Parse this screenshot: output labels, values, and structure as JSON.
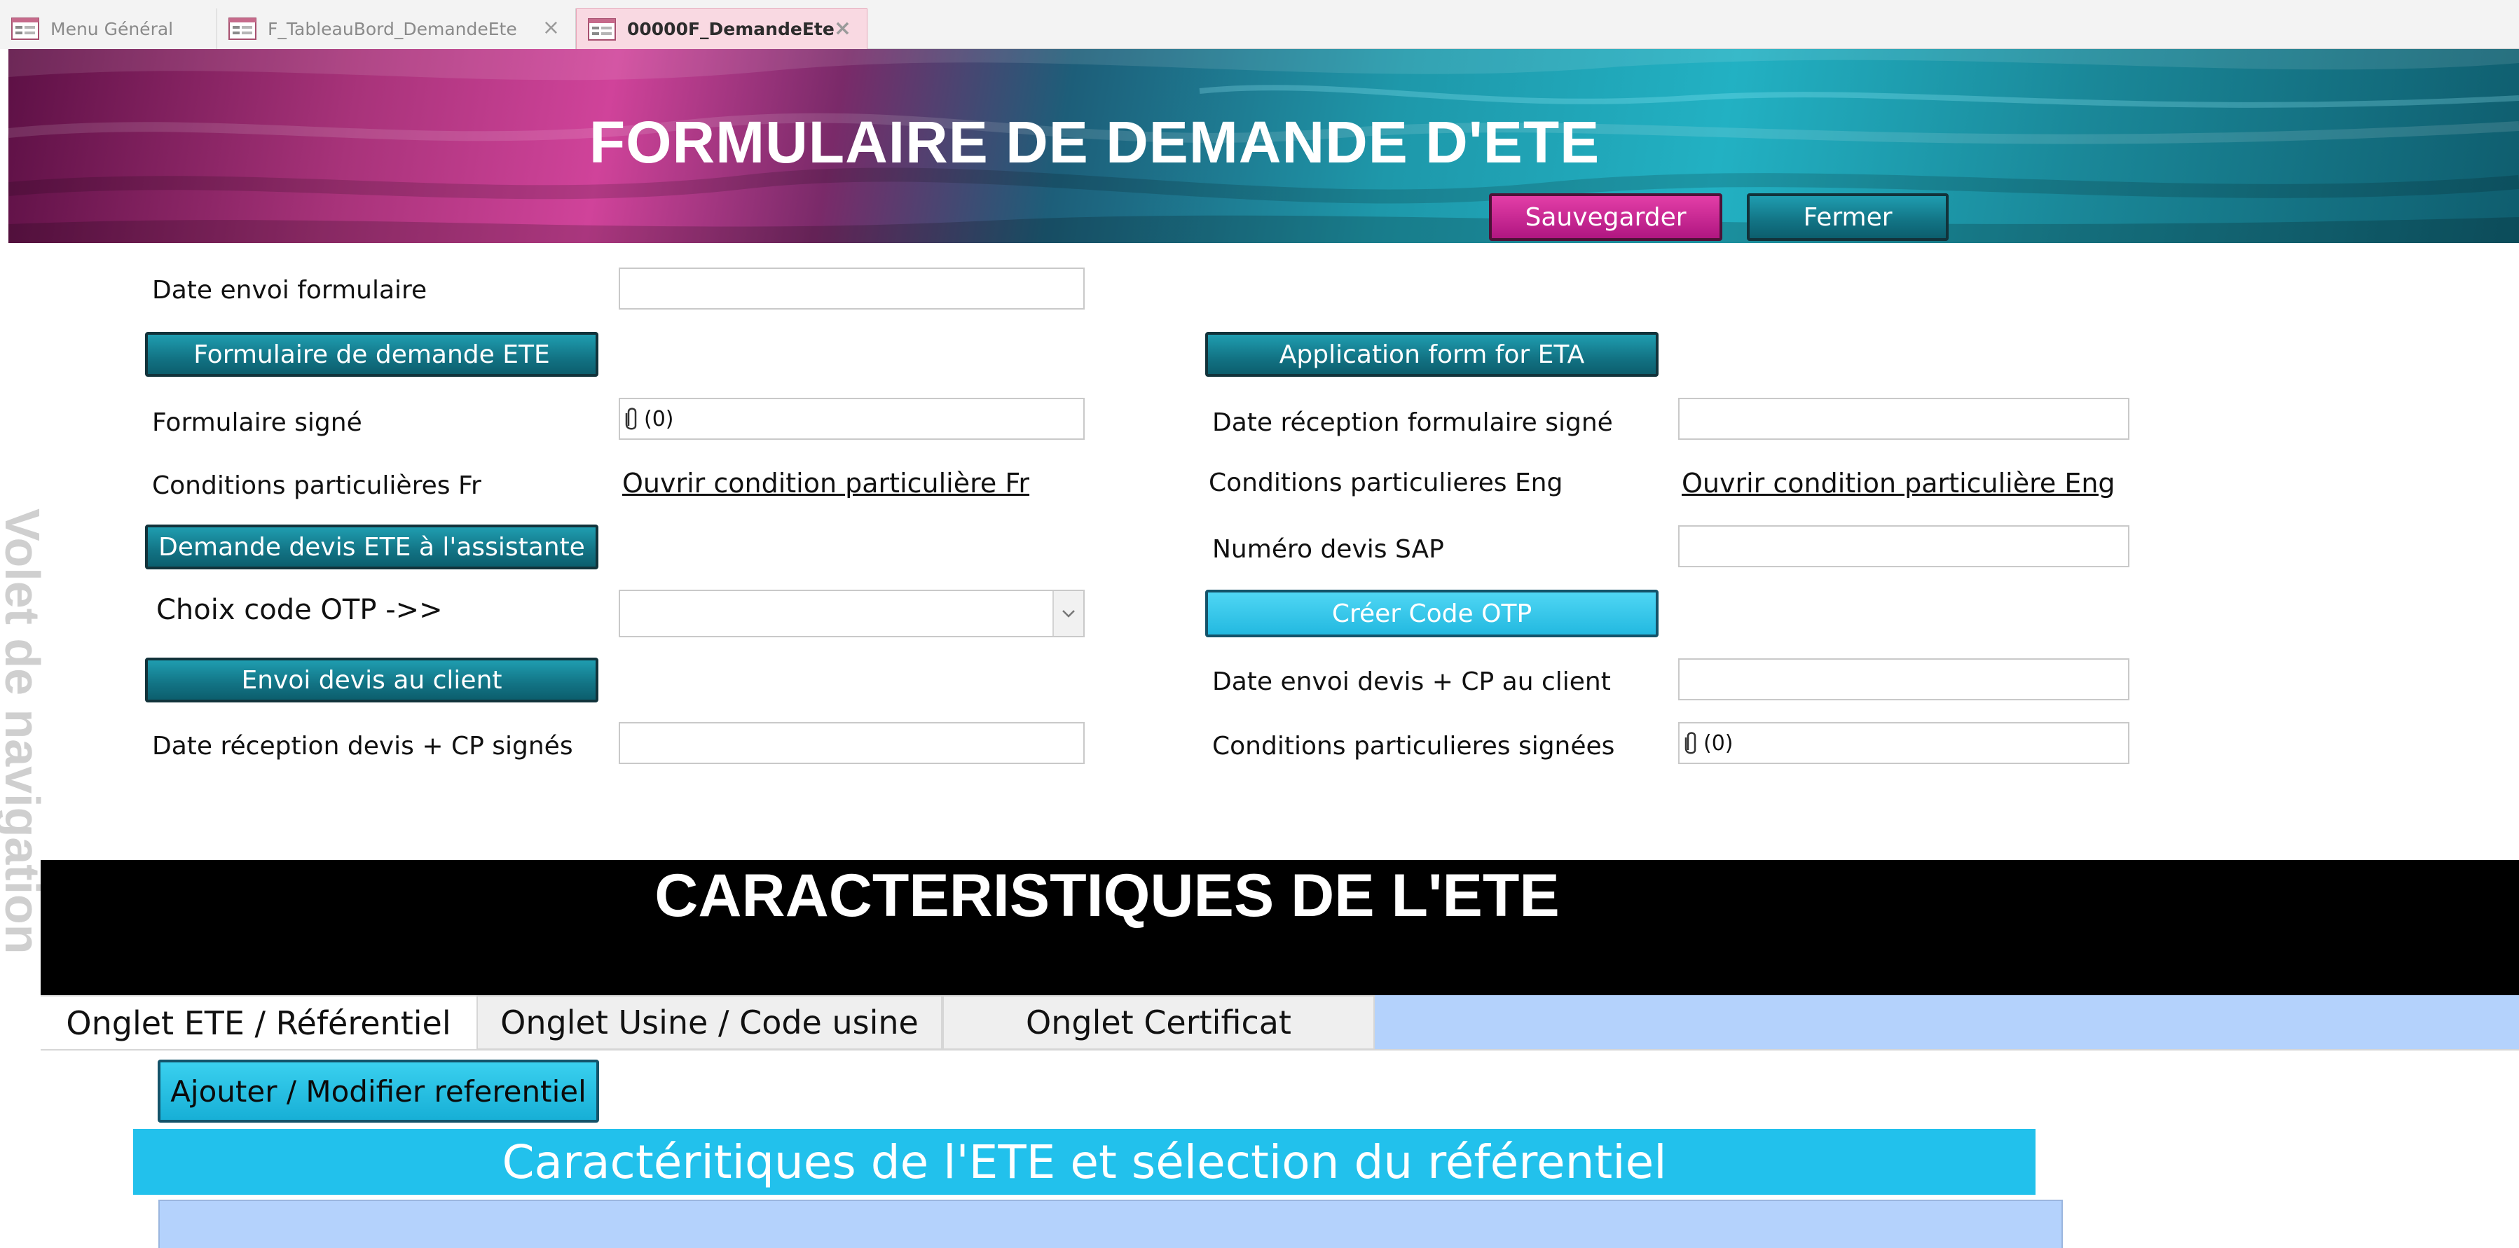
{
  "document_tabs": [
    {
      "label": "Menu Général",
      "icon": "form-icon",
      "active": false
    },
    {
      "label": "F_TableauBord_DemandeEte",
      "icon": "form-icon",
      "active": false,
      "close": "×"
    },
    {
      "label": "00000F_DemandeEte",
      "icon": "form-icon",
      "active": true,
      "close": "×"
    }
  ],
  "header": {
    "title": "FORMULAIRE DE DEMANDE D'ETE",
    "save_button": "Sauvegarder",
    "close_button": "Fermer"
  },
  "navigation_pane_label": "Volet de navigation",
  "form": {
    "date_envoi_label": "Date envoi formulaire",
    "date_envoi_value": "",
    "btn_formulaire_fr": "Formulaire de demande ETE",
    "btn_application_eta": "Application form for ETA",
    "formulaire_signe_label": "Formulaire signé",
    "formulaire_signe_value": "(0)",
    "date_reception_signe_label": "Date réception formulaire signé",
    "date_reception_signe_value": "",
    "conditions_fr_label": "Conditions particulières Fr",
    "conditions_fr_link": "Ouvrir condition particulière Fr",
    "conditions_eng_label": "Conditions particulieres Eng",
    "conditions_eng_link": "Ouvrir condition particulière Eng",
    "btn_demande_devis": "Demande devis ETE à l'assistante",
    "numero_devis_label": "Numéro devis SAP",
    "numero_devis_value": "",
    "choix_otp_label": "Choix code OTP ->>",
    "choix_otp_value": "",
    "btn_creer_otp": "Créer Code OTP",
    "btn_envoi_devis": "Envoi devis au client",
    "date_envoi_devis_label": "Date envoi devis + CP au client",
    "date_envoi_devis_value": "",
    "date_reception_devis_label": "Date réception devis + CP signés",
    "date_reception_devis_value": "",
    "conditions_signees_label": "Conditions particulieres signées",
    "conditions_signees_value": "(0)"
  },
  "section": {
    "title": "CARACTERISTIQUES DE L'ETE",
    "tabs": [
      {
        "label": "Onglet ETE / Référentiel",
        "active": true
      },
      {
        "label": "Onglet Usine / Code usine",
        "active": false
      },
      {
        "label": "Onglet Certificat",
        "active": false
      }
    ],
    "btn_ajouter_referentiel": "Ajouter / Modifier referentiel",
    "subheading": "Caractéritiques de l'ETE et sélection du référentiel"
  },
  "colors": {
    "magenta_button": "#c81f92",
    "teal_button": "#127384",
    "cyan_accent": "#22c1ec",
    "tab_fill_blue": "#b4d2fc",
    "section_band": "#000000"
  }
}
